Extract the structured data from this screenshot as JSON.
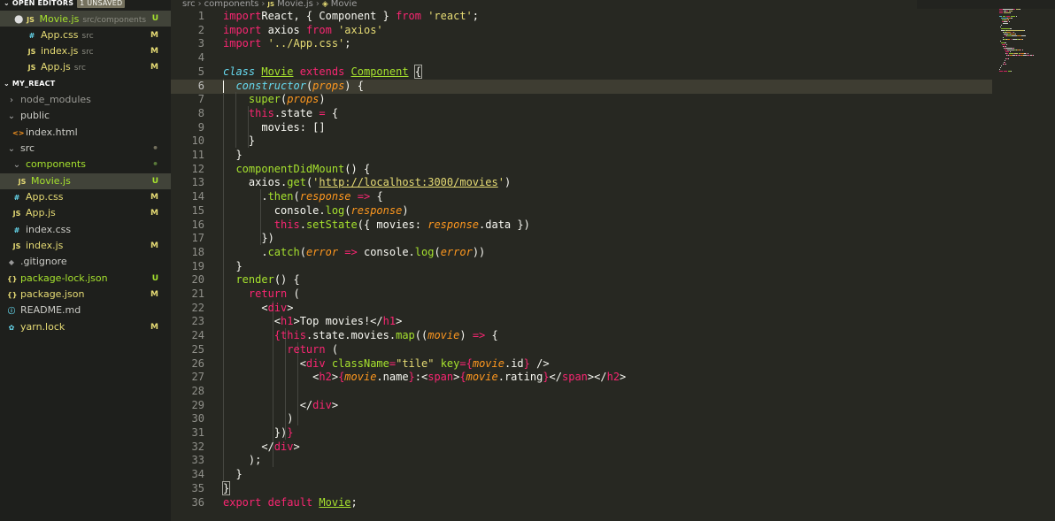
{
  "sidebar": {
    "open_editors": {
      "title": "OPEN EDITORS",
      "badge": "1 UNSAVED",
      "items": [
        {
          "icon": "JS",
          "name": "Movie.js",
          "path": "src/components",
          "flag": "U"
        },
        {
          "icon": "#",
          "name": "App.css",
          "path": "src",
          "flag": "M"
        },
        {
          "icon": "JS",
          "name": "index.js",
          "path": "src",
          "flag": "M"
        },
        {
          "icon": "JS",
          "name": "App.js",
          "path": "src",
          "flag": "M"
        }
      ]
    },
    "project": {
      "title": "MY_REACT",
      "items": [
        {
          "name": "node_modules",
          "flag": ""
        },
        {
          "name": "public",
          "flag": ""
        },
        {
          "icon": "<>",
          "name": "index.html",
          "flag": ""
        },
        {
          "name": "src",
          "flag": "•"
        },
        {
          "name": "components",
          "flag": "•"
        },
        {
          "icon": "JS",
          "name": "Movie.js",
          "flag": "U"
        },
        {
          "icon": "#",
          "name": "App.css",
          "flag": "M"
        },
        {
          "icon": "JS",
          "name": "App.js",
          "flag": "M"
        },
        {
          "icon": "#",
          "name": "index.css",
          "flag": ""
        },
        {
          "icon": "JS",
          "name": "index.js",
          "flag": "M"
        },
        {
          "icon": "◆",
          "name": ".gitignore",
          "flag": ""
        },
        {
          "icon": "{}",
          "name": "package-lock.json",
          "flag": "U"
        },
        {
          "icon": "{}",
          "name": "package.json",
          "flag": "M"
        },
        {
          "icon": "ⓘ",
          "name": "README.md",
          "flag": ""
        },
        {
          "icon": "✿",
          "name": "yarn.lock",
          "flag": "M"
        }
      ]
    }
  },
  "breadcrumb": {
    "parts": [
      "src",
      "components"
    ],
    "file_icon": "JS",
    "file": "Movie.js",
    "symbol_icon": "◈",
    "symbol": "Movie"
  },
  "editor": {
    "current_line": 6,
    "line_numbers": [
      "1",
      "2",
      "3",
      "4",
      "5",
      "6",
      "7",
      "8",
      "9",
      "10",
      "11",
      "12",
      "13",
      "14",
      "15",
      "16",
      "17",
      "18",
      "19",
      "20",
      "21",
      "22",
      "23",
      "24",
      "25",
      "26",
      "27",
      "28",
      "29",
      "30",
      "31",
      "32",
      "33",
      "34",
      "35",
      "36"
    ],
    "lines": [
      [
        [
          "kw",
          "import"
        ],
        [
          "",
          "React, { Component } "
        ],
        [
          "kw",
          "from"
        ],
        [
          "st",
          " 'react'"
        ],
        [
          "",
          ";"
        ]
      ],
      [
        [
          "kw",
          "import"
        ],
        [
          "",
          ""
        ],
        [
          "",
          "axios "
        ],
        [
          "kw",
          "from"
        ],
        [
          "st",
          " 'axios'"
        ]
      ],
      [
        [
          "kw",
          "import"
        ],
        [
          "st",
          " '../App.css'"
        ],
        [
          "",
          ";"
        ]
      ],
      [],
      [
        [
          "cls",
          "class"
        ],
        [
          "",
          ""
        ],
        [
          "nm",
          "Movie"
        ],
        [
          "",
          ""
        ],
        [
          "kw",
          "extends"
        ],
        [
          "",
          ""
        ],
        [
          "nm",
          "Component"
        ],
        [
          "",
          ""
        ],
        [
          "bm",
          "{"
        ]
      ],
      [
        [
          "",
          "  "
        ],
        [
          "cls",
          "constructor"
        ],
        [
          "",
          "("
        ],
        [
          "pr",
          "props"
        ],
        [
          "",
          ") {"
        ]
      ],
      [
        [
          "",
          "    "
        ],
        [
          "fn",
          "super"
        ],
        [
          "",
          "("
        ],
        [
          "pr",
          "props"
        ],
        [
          "",
          ")"
        ]
      ],
      [
        [
          "",
          "    "
        ],
        [
          "kw",
          "this"
        ],
        [
          "",
          ".state "
        ],
        [
          "kw",
          "="
        ],
        [
          "",
          ""
        ],
        [
          "",
          "{"
        ]
      ],
      [
        [
          "",
          "      movies: []"
        ]
      ],
      [
        [
          "",
          "    }"
        ]
      ],
      [
        [
          "",
          "  }"
        ]
      ],
      [
        [
          "",
          "  "
        ],
        [
          "fn",
          "componentDidMount"
        ],
        [
          "",
          "() {"
        ]
      ],
      [
        [
          "",
          "    axios."
        ],
        [
          "fn",
          "get"
        ],
        [
          "",
          "("
        ],
        [
          "st",
          "'"
        ],
        [
          "st url",
          "http://localhost:3000/movies"
        ],
        [
          "st",
          "'"
        ],
        [
          "",
          ")"
        ]
      ],
      [
        [
          "",
          "      ."
        ],
        [
          "fn",
          "then"
        ],
        [
          "",
          "("
        ],
        [
          "pr",
          "response"
        ],
        [
          "",
          ""
        ],
        [
          "kw",
          "=>"
        ],
        [
          "",
          ""
        ],
        [
          "",
          "{"
        ]
      ],
      [
        [
          "",
          "        console."
        ],
        [
          "fn",
          "log"
        ],
        [
          "",
          "("
        ],
        [
          "pr",
          "response"
        ],
        [
          "",
          ")"
        ]
      ],
      [
        [
          "",
          "        "
        ],
        [
          "kw",
          "this"
        ],
        [
          "",
          "."
        ],
        [
          "fn",
          "setState"
        ],
        [
          "",
          "({ movies: "
        ],
        [
          "pr",
          "response"
        ],
        [
          "",
          ".data })"
        ]
      ],
      [
        [
          "",
          "      })"
        ]
      ],
      [
        [
          "",
          "      ."
        ],
        [
          "fn",
          "catch"
        ],
        [
          "",
          "("
        ],
        [
          "pr",
          "error"
        ],
        [
          "",
          ""
        ],
        [
          "kw",
          "=>"
        ],
        [
          "",
          ""
        ],
        [
          "",
          "console."
        ],
        [
          "fn",
          "log"
        ],
        [
          "",
          "("
        ],
        [
          "pr",
          "error"
        ],
        [
          "",
          "))"
        ]
      ],
      [
        [
          "",
          "  }"
        ]
      ],
      [
        [
          "",
          "  "
        ],
        [
          "fn",
          "render"
        ],
        [
          "",
          "() {"
        ]
      ],
      [
        [
          "",
          "    "
        ],
        [
          "kw",
          "return"
        ],
        [
          "",
          ""
        ],
        [
          "",
          "("
        ]
      ],
      [
        [
          "",
          "      <"
        ],
        [
          "tg",
          "div"
        ],
        [
          "",
          ">"
        ]
      ],
      [
        [
          "",
          "        <"
        ],
        [
          "tg",
          "h1"
        ],
        [
          "",
          ">Top movies!</"
        ],
        [
          "tg",
          "h1"
        ],
        [
          "",
          ">"
        ]
      ],
      [
        [
          "",
          "        "
        ],
        [
          "kw",
          "{"
        ],
        [
          "kw",
          "this"
        ],
        [
          "",
          ".state.movies."
        ],
        [
          "fn",
          "map"
        ],
        [
          "",
          "(("
        ],
        [
          "pr",
          "movie"
        ],
        [
          "",
          ") "
        ],
        [
          "kw",
          "=>"
        ],
        [
          "",
          ""
        ],
        [
          "",
          "{"
        ]
      ],
      [
        [
          "",
          "          "
        ],
        [
          "kw",
          "return"
        ],
        [
          "",
          ""
        ],
        [
          "",
          "("
        ]
      ],
      [
        [
          "",
          "            <"
        ],
        [
          "tg",
          "div"
        ],
        [
          "",
          ""
        ],
        [
          "at",
          "className"
        ],
        [
          "kw",
          "="
        ],
        [
          "st",
          "\"tile\""
        ],
        [
          "",
          ""
        ],
        [
          "at",
          "key"
        ],
        [
          "kw",
          "={"
        ],
        [
          "pr",
          "movie"
        ],
        [
          "",
          ".id"
        ],
        [
          "kw",
          "}"
        ],
        [
          "",
          ""
        ],
        [
          "",
          "/>"
        ]
      ],
      [
        [
          "",
          "              <"
        ],
        [
          "tg",
          "h2"
        ],
        [
          "",
          ">"
        ],
        [
          "kw",
          "{"
        ],
        [
          "pr",
          "movie"
        ],
        [
          "",
          ".name"
        ],
        [
          "kw",
          "}"
        ],
        [
          "",
          ":<"
        ],
        [
          "tg",
          "span"
        ],
        [
          "",
          ">"
        ],
        [
          "kw",
          "{"
        ],
        [
          "pr",
          "movie"
        ],
        [
          "",
          ".rating"
        ],
        [
          "kw",
          "}"
        ],
        [
          "",
          "</"
        ],
        [
          "tg",
          "span"
        ],
        [
          "",
          "></"
        ],
        [
          "tg",
          "h2"
        ],
        [
          "",
          ">"
        ]
      ],
      [],
      [
        [
          "",
          "            </"
        ],
        [
          "tg",
          "div"
        ],
        [
          "",
          ">"
        ]
      ],
      [
        [
          "",
          "          )"
        ]
      ],
      [
        [
          "",
          "        })"
        ],
        [
          "kw",
          "}"
        ]
      ],
      [
        [
          "",
          "      </"
        ],
        [
          "tg",
          "div"
        ],
        [
          "",
          ">"
        ]
      ],
      [
        [
          "",
          "    );"
        ]
      ],
      [
        [
          "",
          "  }"
        ]
      ],
      [
        [
          "bm",
          "}"
        ]
      ],
      [
        [
          "kw",
          "export"
        ],
        [
          "",
          ""
        ],
        [
          "kw",
          "default"
        ],
        [
          "",
          ""
        ],
        [
          "nm",
          "Movie"
        ],
        [
          "",
          ";"
        ]
      ]
    ]
  },
  "colors": {
    "background": "#272822",
    "sidebar": "#1e1f1c",
    "keyword": "#f92672",
    "string": "#e6db74",
    "function": "#a6e22e",
    "param": "#fd971f",
    "class": "#66d9ef"
  }
}
